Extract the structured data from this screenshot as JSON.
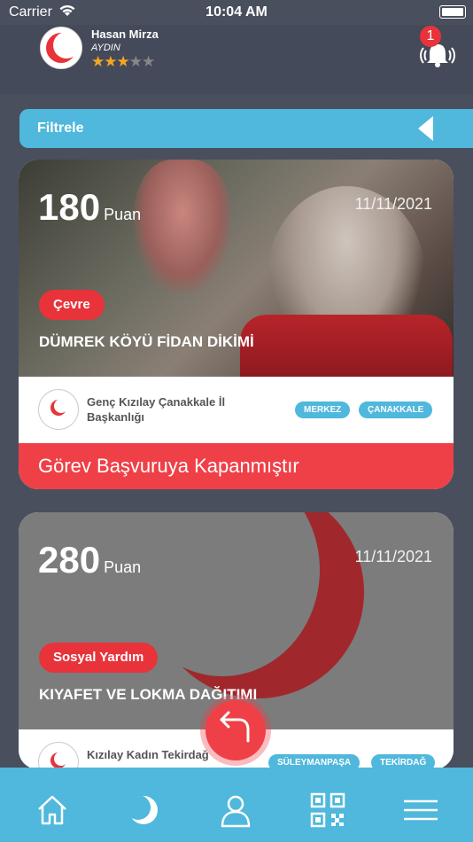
{
  "status": {
    "carrier": "Carrier",
    "time": "10:04 AM"
  },
  "user": {
    "name": "Hasan Mirza",
    "city": "AYDIN",
    "rating": 3,
    "max_rating": 5
  },
  "notifications": {
    "count": "1"
  },
  "filter": {
    "label": "Filtrele"
  },
  "cards": [
    {
      "points": "180",
      "points_unit": "Puan",
      "date": "11/11/2021",
      "category": "Çevre",
      "title": "DÜMREK KÖYÜ FİDAN DİKİMİ",
      "org": "Genç Kızılay Çanakkale İl Başkanlığı",
      "chips": [
        "MERKEZ",
        "ÇANAKKALE"
      ],
      "status": "Görev Başvuruya Kapanmıştır"
    },
    {
      "points": "280",
      "points_unit": "Puan",
      "date": "11/11/2021",
      "category": "Sosyal Yardım",
      "title": "KIYAFET VE LOKMA DAĞITIMI",
      "org": "Kızılay Kadın Tekirdağ",
      "chips": [
        "SÜLEYMANPAŞA",
        "TEKİRDAĞ"
      ]
    }
  ],
  "colors": {
    "accent_blue": "#4fb8dc",
    "red": "#ef4047",
    "background": "#4a4f5e"
  },
  "tabbar": {
    "icons": [
      "home-icon",
      "crescent-icon",
      "profile-icon",
      "qr-code-icon",
      "menu-icon"
    ]
  }
}
